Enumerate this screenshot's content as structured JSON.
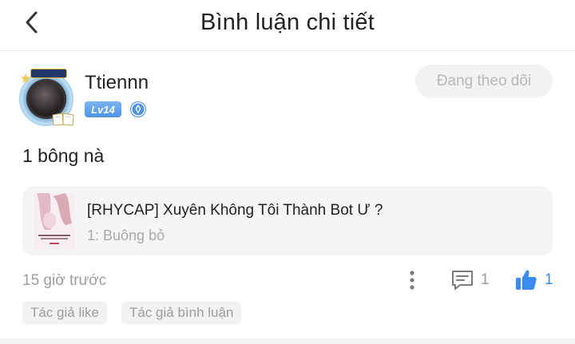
{
  "header": {
    "title": "Bình luận chi tiết",
    "back_icon": "chevron-left-icon"
  },
  "user": {
    "name": "Ttiennn",
    "level": "Lv14",
    "vip_icon": "diamond-badge-icon",
    "follow_label": "Đang theo dõi"
  },
  "comment": {
    "text": "1 bông nà"
  },
  "book": {
    "title": "[RHYCAP] Xuyên Không Tôi Thành Bot Ư ?",
    "chapter": "1: Buông bỏ"
  },
  "footer": {
    "timestamp": "15 giờ trước",
    "reply_count": "1",
    "like_count": "1"
  },
  "tags": [
    "Tác giả like",
    "Tác giả bình luận"
  ],
  "colors": {
    "accent": "#3b8cf0",
    "level_badge": "#4d93e6",
    "muted_text": "#9d9d9d",
    "follow_bg": "#f2f2f2"
  }
}
